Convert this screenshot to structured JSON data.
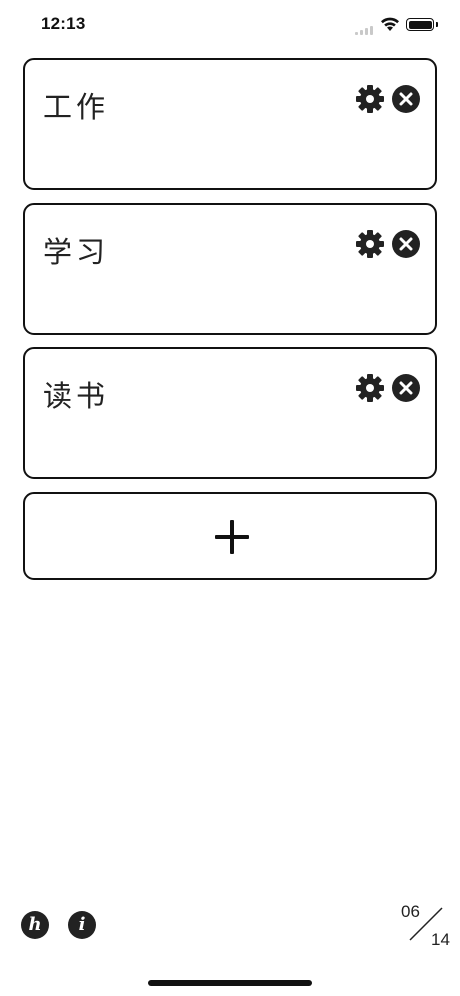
{
  "status_bar": {
    "time": "12:13"
  },
  "cards": [
    {
      "title": "工作",
      "settings_icon": "gear-icon",
      "close_icon": "close-circle-icon"
    },
    {
      "title": "学习",
      "settings_icon": "gear-icon",
      "close_icon": "close-circle-icon"
    },
    {
      "title": "读书",
      "settings_icon": "gear-icon",
      "close_icon": "close-circle-icon"
    }
  ],
  "add_button": {
    "icon": "plus-icon"
  },
  "footer": {
    "help_icon_glyph": "h",
    "info_icon_glyph": "i",
    "date": {
      "month": "06",
      "day": "14"
    }
  },
  "colors": {
    "foreground": "#111111",
    "background": "#ffffff"
  }
}
